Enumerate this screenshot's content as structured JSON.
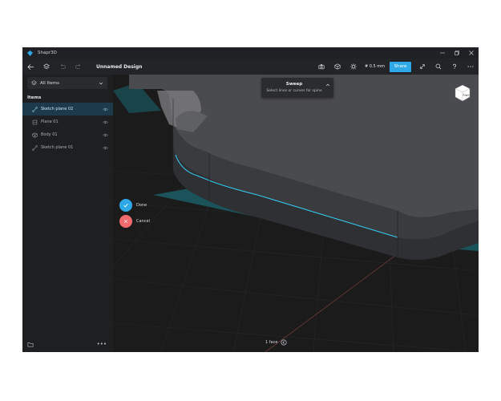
{
  "window": {
    "app_title": "Shapr3D"
  },
  "toolbar": {
    "document_title": "Unnamed Design",
    "snap_value": "# 0.5 mm",
    "share_label": "Share"
  },
  "sidebar": {
    "dropdown_label": "All Items",
    "items_heading": "Items",
    "items": [
      {
        "label": "Sketch plane 02",
        "icon": "sketch-icon",
        "selected": true
      },
      {
        "label": "Plane 01",
        "icon": "plane-icon",
        "selected": false
      },
      {
        "label": "Body 01",
        "icon": "body-icon",
        "selected": false
      },
      {
        "label": "Sketch plane 01",
        "icon": "sketch-icon",
        "selected": false
      }
    ],
    "more_label": "•••"
  },
  "sweep_panel": {
    "title": "Sweep",
    "subtitle": "Select lines or curves for spine"
  },
  "actions": {
    "done_label": "Done",
    "cancel_label": "Cancel"
  },
  "view_cube": {
    "face_label": "Right"
  },
  "status": {
    "text": "1 face"
  },
  "colors": {
    "accent": "#2fa8e8",
    "done": "#2fa8e8",
    "cancel": "#f06b6e",
    "selection": "#1d3a4a",
    "highlight_edge": "#35c9f0"
  }
}
